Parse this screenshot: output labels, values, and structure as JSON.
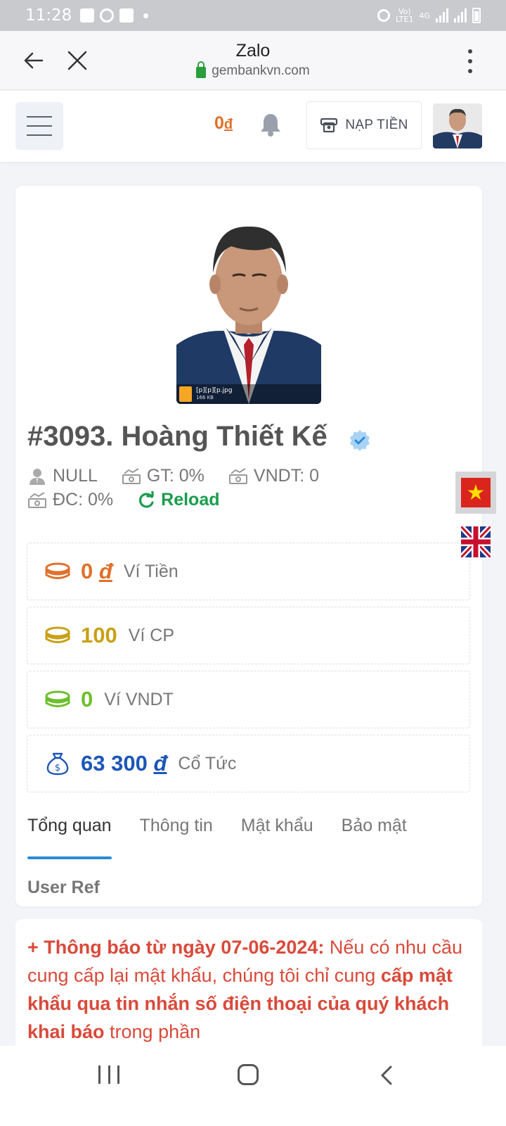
{
  "status_bar": {
    "time": "11:28",
    "network": "LTE1",
    "network_top": "Vo)",
    "net_type": "4G"
  },
  "browser": {
    "title": "Zalo",
    "url": "gembankvn.com"
  },
  "header": {
    "balance": "0",
    "currency": "đ",
    "deposit_label": "NẠP TIỀN"
  },
  "profile": {
    "photo_file": "[p][p][p.jpg",
    "photo_size": "166 KB",
    "name": "#3093. Hoàng Thiết Kế",
    "rank": "NULL",
    "gt": "GT: 0%",
    "vndt": "VNDT: 0",
    "dc": "ĐC: 0%",
    "reload_label": "Reload"
  },
  "wallets": [
    {
      "amount": "0",
      "currency": "đ",
      "label": "Ví Tiền",
      "color": "#e0702a"
    },
    {
      "amount": "100",
      "currency": "",
      "label": "Ví CP",
      "color": "#c9a014"
    },
    {
      "amount": "0",
      "currency": "",
      "label": "Ví VNDT",
      "color": "#6cbf2b"
    },
    {
      "amount": "63 300",
      "currency": "đ",
      "label": "Cổ Tức",
      "color": "#1c56b8"
    }
  ],
  "tabs": [
    {
      "label": "Tổng quan",
      "active": true
    },
    {
      "label": "Thông tin",
      "active": false
    },
    {
      "label": "Mật khẩu",
      "active": false
    },
    {
      "label": "Bảo mật",
      "active": false
    },
    {
      "label": "User Ref",
      "active": false
    }
  ],
  "notice": {
    "heading": "+ Thông báo từ ngày 07-06-2024:",
    "text1": " Nếu có nhu cầu cung cấp lại mật khẩu, chúng tôi chỉ cung ",
    "bold": "cấp mật khẩu qua tin nhắn số điện thoại của quý khách khai báo",
    "text2": " trong phần"
  },
  "colors": {
    "accent_blue": "#2a8cd6",
    "orange": "#e0702a",
    "notice_red": "#d94a3a",
    "reload_green": "#1a9c4c"
  },
  "icons": [
    "back-arrow-icon",
    "close-icon",
    "lock-icon",
    "more-vert-icon",
    "hamburger-icon",
    "bell-icon",
    "wallet-icon",
    "verified-icon",
    "user-icon",
    "money-icon",
    "reload-icon",
    "coin-icon",
    "money-bag-icon",
    "flag-vn-icon",
    "flag-uk-icon"
  ]
}
